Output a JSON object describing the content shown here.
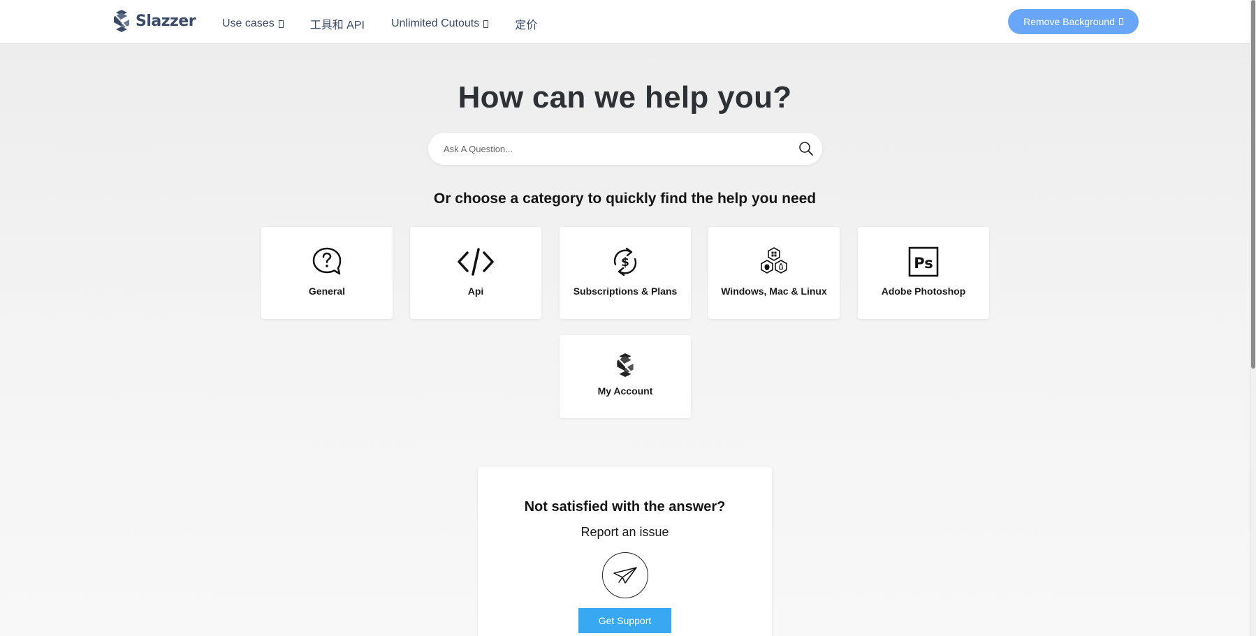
{
  "header": {
    "brand": "Slazzer",
    "nav": [
      {
        "label": "Use cases",
        "has_caret": true
      },
      {
        "label": "工具和 API",
        "has_caret": false
      },
      {
        "label": "Unlimited Cutouts",
        "has_caret": true
      },
      {
        "label": "定价",
        "has_caret": false
      }
    ],
    "cta_label": "Remove Background"
  },
  "hero": {
    "title": "How can we help you?",
    "search_placeholder": "Ask A Question...",
    "subtitle": "Or choose a category to quickly find the help you need"
  },
  "categories": [
    {
      "label": "General",
      "icon": "question-bubble-icon"
    },
    {
      "label": "Api",
      "icon": "code-icon"
    },
    {
      "label": "Subscriptions & Plans",
      "icon": "dollar-cycle-icon"
    },
    {
      "label": "Windows, Mac & Linux",
      "icon": "os-hexagons-icon"
    },
    {
      "label": "Adobe Photoshop",
      "icon": "photoshop-icon"
    },
    {
      "label": "My Account",
      "icon": "slazzer-logo-icon"
    }
  ],
  "support": {
    "title": "Not satisfied with the answer?",
    "subtitle": "Report an issue",
    "button_label": "Get Support",
    "icon": "paper-plane-icon"
  },
  "colors": {
    "brand_text": "#3b4a66",
    "cta_bg": "#6aa6f8",
    "support_button": "#38a8f2"
  }
}
